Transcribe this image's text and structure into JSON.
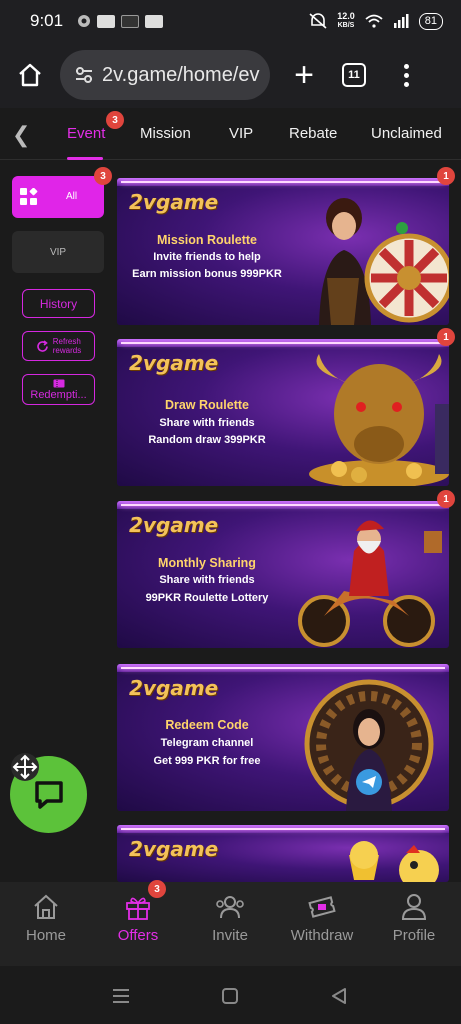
{
  "status_bar": {
    "time": "9:01",
    "net_speed_value": "12.0",
    "net_speed_unit": "KB/S",
    "battery": "81"
  },
  "browser": {
    "url": "2v.game/home/ev",
    "tab_count": "11"
  },
  "tabs": [
    {
      "label": "Event",
      "badge": "3",
      "active": true
    },
    {
      "label": "Mission"
    },
    {
      "label": "VIP"
    },
    {
      "label": "Rebate"
    },
    {
      "label": "Unclaimed"
    }
  ],
  "sidebar": {
    "all_label": "All",
    "all_badge": "3",
    "vip_label": "VIP",
    "history_label": "History",
    "refresh_line1": "Refresh",
    "refresh_line2": "rewards",
    "redemption_label": "Redempti..."
  },
  "banners": [
    {
      "logo": "2vgame",
      "title": "Mission Roulette",
      "line1": "Invite friends to help",
      "line2": "Earn mission bonus 999PKR",
      "badge": "1"
    },
    {
      "logo": "2vgame",
      "title": "Draw Roulette",
      "line1": "Share with friends",
      "line2": "Random draw 399PKR",
      "badge": "1"
    },
    {
      "logo": "2vgame",
      "title": "Monthly Sharing",
      "line1": "Share with friends",
      "line2": "99PKR Roulette Lottery",
      "badge": "1"
    },
    {
      "logo": "2vgame",
      "title": "Redeem Code",
      "line1": "Telegram channel",
      "line2": "Get 999 PKR for free"
    },
    {
      "logo": "2vgame"
    }
  ],
  "bottom_nav": [
    {
      "label": "Home",
      "icon": "home-icon"
    },
    {
      "label": "Offers",
      "icon": "gift-icon",
      "badge": "3",
      "active": true
    },
    {
      "label": "Invite",
      "icon": "people-icon"
    },
    {
      "label": "Withdraw",
      "icon": "ticket-icon"
    },
    {
      "label": "Profile",
      "icon": "person-icon"
    }
  ],
  "colors": {
    "accent": "#e22ee6",
    "badge": "#e0453d",
    "chat_fab": "#5cc23a",
    "banner_title": "#ffd46b"
  }
}
